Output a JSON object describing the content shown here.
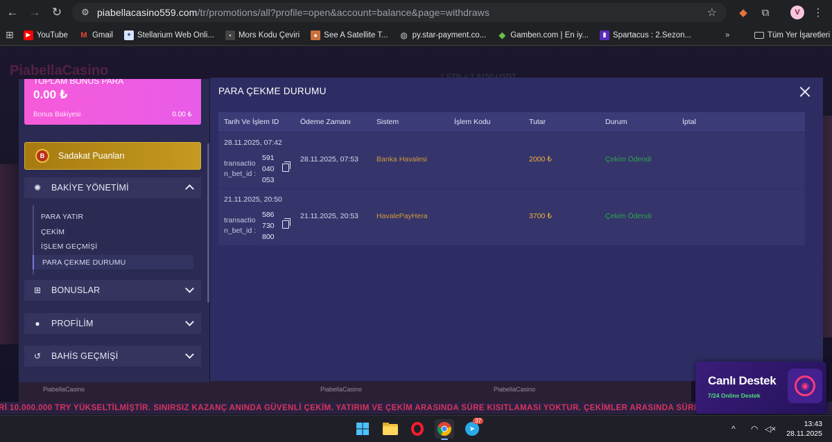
{
  "browser": {
    "url_host": "piabellacasino559.com",
    "url_path": "/tr/promotions/all?profile=open&account=balance&page=withdraws",
    "profile_initial": "V"
  },
  "bookmarks": [
    {
      "label": "YouTube",
      "icon": "youtube-icon",
      "color": "#ff0000"
    },
    {
      "label": "Gmail",
      "icon": "gmail-icon",
      "color": "#ea4335"
    },
    {
      "label": "Stellarium Web Onli...",
      "icon": "stellarium-icon",
      "color": "#4a7bd8"
    },
    {
      "label": "Mors Kodu Çeviri",
      "icon": "morse-icon",
      "color": "#555555"
    },
    {
      "label": "See A Satellite T...",
      "icon": "satellite-icon",
      "color": "#3c6bd6"
    },
    {
      "label": "py.star-payment.co...",
      "icon": "globe-icon",
      "color": "#9aa0a6"
    },
    {
      "label": "Gamben.com | En iy...",
      "icon": "gamben-icon",
      "color": "#6ac043"
    },
    {
      "label": "Spartacus : 2.Sezon...",
      "icon": "spartacus-icon",
      "color": "#5a2dbf"
    }
  ],
  "bookmarks_all_label": "Tüm Yer İşaretleri",
  "sidebar": {
    "bonus_title": "TOPLAM BONUS PARA",
    "bonus_value": "0.00 ₺",
    "bonus_balance_label": "Bonus Bakiyesi",
    "bonus_balance_value": "0.00 ₺",
    "loyalty_label": "Sadakat Puanları",
    "balance_mgmt_label": "BAKİYE YÖNETİMİ",
    "submenu": [
      {
        "label": "PARA YATIR"
      },
      {
        "label": "ÇEKİM"
      },
      {
        "label": "İŞLEM GEÇMİŞİ"
      },
      {
        "label": "PARA ÇEKME DURUMU"
      }
    ],
    "bonuses_label": "BONUSLAR",
    "profile_label": "PROFİLİM",
    "bet_history_label": "BAHİS GEÇMİŞİ"
  },
  "modal": {
    "title": "PARA ÇEKME DURUMU",
    "columns": [
      "Tarih Ve İşlem ID",
      "Ödeme Zamanı",
      "Sistem",
      "İşlem Kodu",
      "Tutar",
      "Durum",
      "İptal"
    ],
    "rows": [
      {
        "date": "28.11.2025, 07:42",
        "tx_label": "transactio n_bet_id :",
        "tx_id": "591 040 053",
        "paid_at": "28.11.2025, 07:53",
        "system": "Banka Havalesi",
        "code": "",
        "amount": "2000 ₺",
        "status": "Çekim Ödendi",
        "cancel": ""
      },
      {
        "date": "21.11.2025, 20:50",
        "tx_label": "transactio n_bet_id :",
        "tx_id": "586 730 800",
        "paid_at": "21.11.2025, 20:53",
        "system": "HavalePayHera",
        "code": "",
        "amount": "3700 ₺",
        "status": "Çekim Ödendi",
        "cancel": ""
      }
    ]
  },
  "header_faint": {
    "logo": "PiabellaCasino",
    "rate": "1 FTN = 1.8150 USDT"
  },
  "ticker": "Rİ 10.000.000 TRY YÜKSELTİLMİŞTİR. SINIRSIZ KAZANÇ ANINDA GÜVENLİ ÇEKİM. YATIRIM VE ÇEKİM ARASINDA SÜRE KISITLAMASI YOKTUR. ÇEKİMLER ARASINDA SÜRE KISITLA",
  "support": {
    "title": "Canlı Destek",
    "subtitle": "7/24 Online Destek"
  },
  "taskbar": {
    "telegram_badge": "37",
    "time": "13:43",
    "date": "28.11.2025"
  }
}
